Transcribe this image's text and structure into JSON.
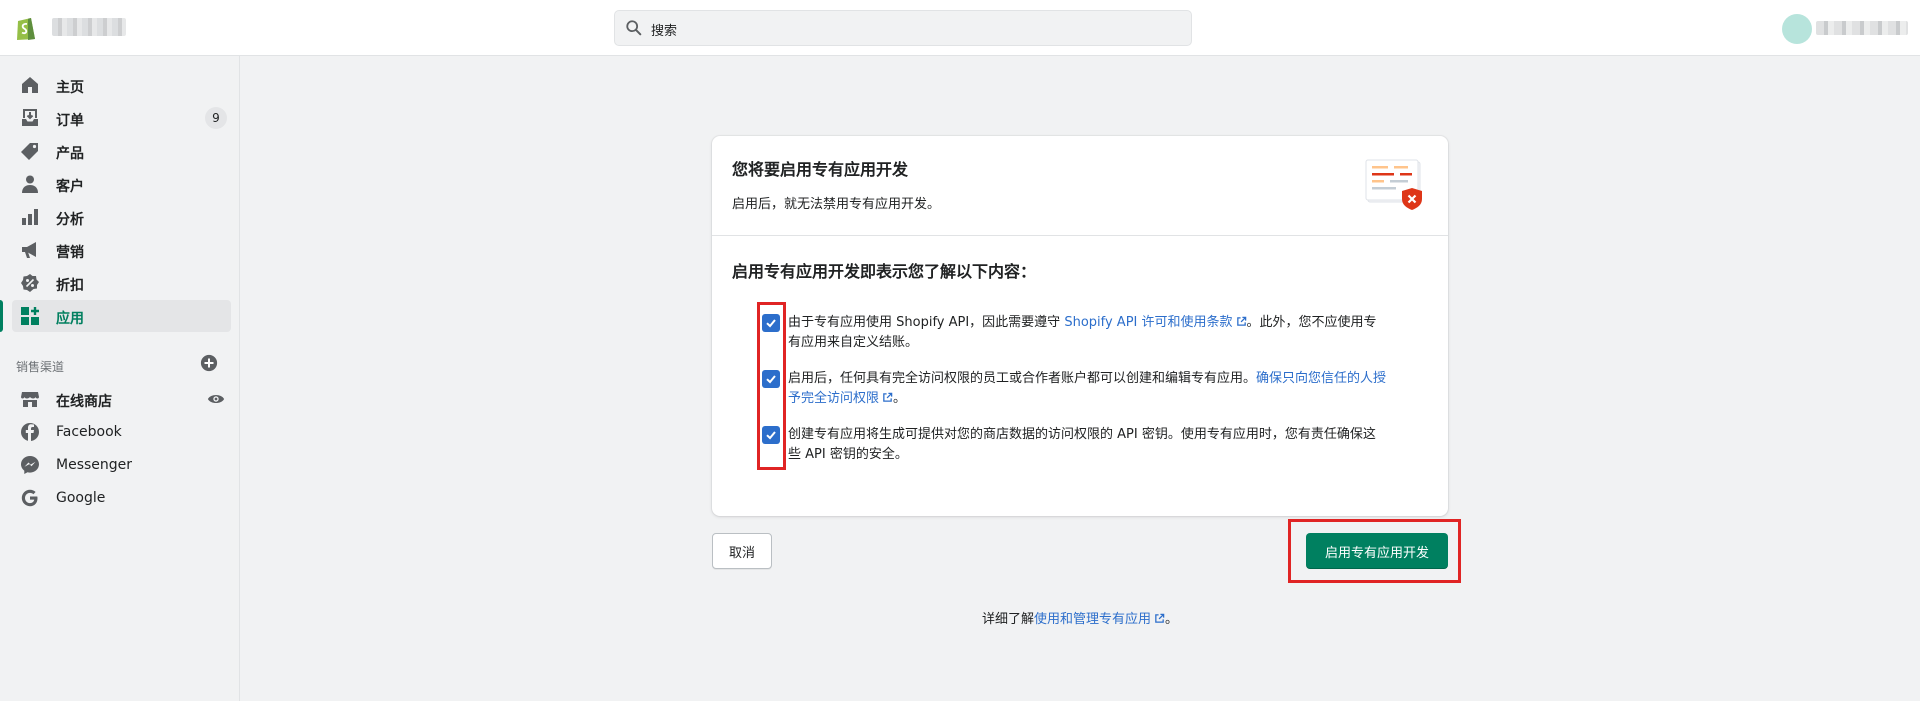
{
  "topbar": {
    "search_placeholder": "搜索"
  },
  "sidebar": {
    "items": [
      {
        "label": "主页"
      },
      {
        "label": "订单",
        "badge": "9"
      },
      {
        "label": "产品"
      },
      {
        "label": "客户"
      },
      {
        "label": "分析"
      },
      {
        "label": "营销"
      },
      {
        "label": "折扣"
      },
      {
        "label": "应用",
        "active": true
      }
    ],
    "sales_channels_title": "销售渠道",
    "channels": [
      {
        "label": "在线商店"
      },
      {
        "label": "Facebook"
      },
      {
        "label": "Messenger"
      },
      {
        "label": "Google"
      }
    ]
  },
  "card": {
    "title": "您将要启用专有应用开发",
    "subtitle": "启用后，就无法禁用专有应用开发。",
    "section_heading": "启用专有应用开发即表示您了解以下内容：",
    "items": [
      {
        "text_before": "由于专有应用使用 Shopify API，因此需要遵守 ",
        "link": "Shopify API 许可和使用条款",
        "text_after": "。此外，您不应使用专有应用来自定义结账。",
        "checked": true
      },
      {
        "text_before": "启用后，任何具有完全访问权限的员工或合作者账户都可以创建和编辑专有应用。",
        "link": "确保只向您信任的人授予完全访问权限",
        "text_after": "。",
        "checked": true
      },
      {
        "text_before": "创建专有应用将生成可提供对您的商店数据的访问权限的 API 密钥。使用专有应用时，您有责任确保这些 API 密钥的安全。",
        "link": "",
        "text_after": "",
        "checked": true
      }
    ]
  },
  "actions": {
    "cancel_label": "取消",
    "enable_label": "启用专有应用开发"
  },
  "footer": {
    "text_before": "详细了解",
    "link": "使用和管理专有应用",
    "text_after": "。"
  },
  "colors": {
    "primary": "#008060",
    "link": "#2c6ecb",
    "highlight": "#e02424"
  }
}
